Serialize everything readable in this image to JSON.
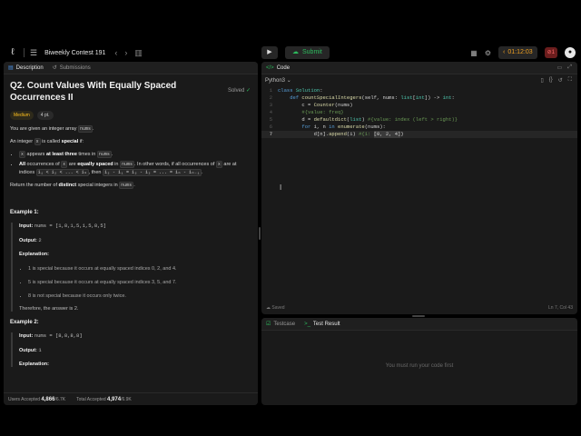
{
  "topbar": {
    "contest_title": "Biweekly Contest 191",
    "submit_label": "Submit",
    "timer": "01:12:03",
    "penalty_badge": "1"
  },
  "left": {
    "tabs": [
      {
        "label": "Description",
        "icon": "document-icon"
      },
      {
        "label": "Submissions",
        "icon": "history-icon"
      }
    ],
    "title": "Q2. Count Values With Equally Spaced Occurrences II",
    "solved_label": "Solved",
    "difficulty": "Medium",
    "points": "4 pt.",
    "desc": {
      "p1_a": "You are given an integer array ",
      "p1_code": "nums",
      "p1_b": ".",
      "p2_a": "An integer ",
      "p2_code": "x",
      "p2_b": " is called ",
      "p2_bold": "special",
      "p2_c": " if:",
      "li1_code": "x",
      "li1_a": " appears ",
      "li1_bold": "at least three",
      "li1_b": " times in ",
      "li1_code2": "nums",
      "li1_c": ".",
      "li2_bold1": "All",
      "li2_a": " occurrences of ",
      "li2_code": "x",
      "li2_b": " are ",
      "li2_bold2": "equally spaced",
      "li2_c": " in ",
      "li2_code2": "nums",
      "li2_d": ". In other words, if all occurrences of ",
      "li2_code3": "x",
      "li2_e": " are at indices ",
      "li2_code4": "i₁ < i₂ < ... < iₘ",
      "li2_f": ", then ",
      "li2_code5": "i₂ - i₁ = i₃ - i₂ = ... = iₘ - iₘ₋₁",
      "li2_g": ".",
      "p3_a": "Return the number of ",
      "p3_bold": "distinct",
      "p3_b": " special integers in ",
      "p3_code": "nums",
      "p3_c": "."
    },
    "example1": {
      "title": "Example 1:",
      "input_label": "Input:",
      "input": "nums = [1,8,1,5,1,5,8,5]",
      "output_label": "Output:",
      "output": "2",
      "expl_label": "Explanation:",
      "items": [
        "1 is special because it occurs at equally spaced indices 0, 2, and 4.",
        "5 is special because it occurs at equally spaced indices 3, 5, and 7.",
        "8 is not special because it occurs only twice."
      ],
      "conclusion": "Therefore, the answer is 2."
    },
    "example2": {
      "title": "Example 2:",
      "input_label": "Input:",
      "input": "nums = [8,8,8,8]",
      "output_label": "Output:",
      "output": "1",
      "expl_label": "Explanation:"
    },
    "footer": {
      "users_label": "Users Accepted",
      "users_value": "4,866",
      "users_total": "/6.7K",
      "total_label": "Total Accepted",
      "total_value": "4,974",
      "total_total": "/6.9K"
    }
  },
  "code": {
    "header": "Code",
    "language": "Python3",
    "status": "Saved",
    "cursor_pos": "Ln 7, Col 43",
    "lines": [
      {
        "n": "1"
      },
      {
        "n": "2"
      },
      {
        "n": "3"
      },
      {
        "n": "4"
      },
      {
        "n": "5"
      },
      {
        "n": "6"
      },
      {
        "n": "7"
      }
    ]
  },
  "test": {
    "tabs": [
      {
        "label": "Testcase"
      },
      {
        "label": "Test Result"
      }
    ],
    "message": "You must run your code first"
  },
  "colors": {
    "accent_green": "#2cbb5d",
    "medium": "#ffc01e",
    "timer": "#f0a020"
  }
}
